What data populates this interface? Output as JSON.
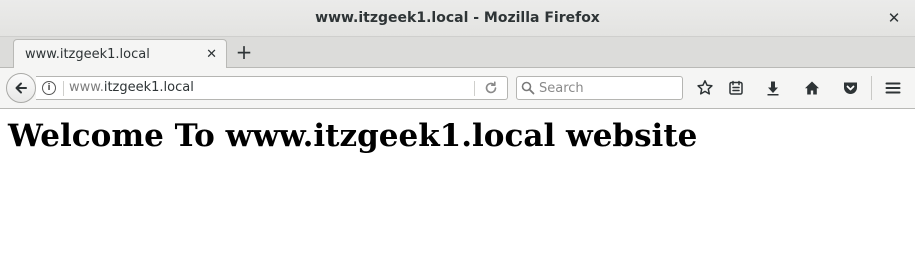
{
  "window": {
    "title": "www.itzgeek1.local - Mozilla Firefox"
  },
  "tabs": [
    {
      "label": "www.itzgeek1.local",
      "active": true
    }
  ],
  "urlbar": {
    "prefix": "www.",
    "host": "itzgeek1.local"
  },
  "search": {
    "placeholder": "Search"
  },
  "toolbar": {
    "icons": [
      "star-icon",
      "reading-list-icon",
      "download-icon",
      "home-icon",
      "pocket-icon",
      "menu-icon"
    ]
  },
  "page": {
    "heading": "Welcome To www.itzgeek1.local website"
  },
  "colors": {
    "chrome_bg": "#e8e8e7",
    "tab_active": "#f5f5f4",
    "text": "#2e3436"
  }
}
